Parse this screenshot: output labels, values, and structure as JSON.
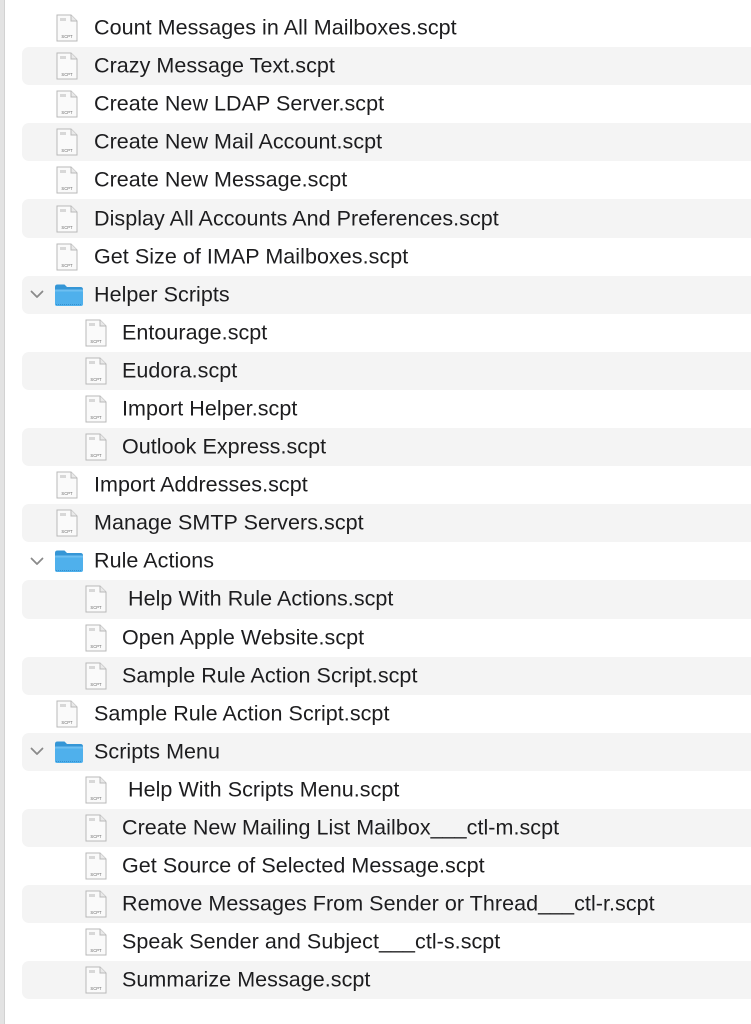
{
  "tree": {
    "items": [
      {
        "label": "Count Messages in All Mailboxes.scpt",
        "kind": "file",
        "level": 0,
        "icon": "scpt-file-icon",
        "icon_tag": "SCPT"
      },
      {
        "label": "Crazy Message Text.scpt",
        "kind": "file",
        "level": 0,
        "icon": "scpt-file-icon",
        "icon_tag": "SCPT"
      },
      {
        "label": "Create New LDAP Server.scpt",
        "kind": "file",
        "level": 0,
        "icon": "scpt-file-icon",
        "icon_tag": "SCPT"
      },
      {
        "label": "Create New Mail Account.scpt",
        "kind": "file",
        "level": 0,
        "icon": "scpt-file-icon",
        "icon_tag": "SCPT"
      },
      {
        "label": "Create New Message.scpt",
        "kind": "file",
        "level": 0,
        "icon": "scpt-file-icon",
        "icon_tag": "SCPT"
      },
      {
        "label": "Display All Accounts And Preferences.scpt",
        "kind": "file",
        "level": 0,
        "icon": "scpt-file-icon",
        "icon_tag": "SCPT"
      },
      {
        "label": "Get Size of IMAP Mailboxes.scpt",
        "kind": "file",
        "level": 0,
        "icon": "scpt-file-icon",
        "icon_tag": "SCPT"
      },
      {
        "label": "Helper Scripts",
        "kind": "folder",
        "level": 0,
        "expanded": true,
        "icon": "folder-icon"
      },
      {
        "label": "Entourage.scpt",
        "kind": "file",
        "level": 1,
        "icon": "scpt-file-icon",
        "icon_tag": "SCPT"
      },
      {
        "label": "Eudora.scpt",
        "kind": "file",
        "level": 1,
        "icon": "scpt-file-icon",
        "icon_tag": "SCPT"
      },
      {
        "label": "Import Helper.scpt",
        "kind": "file",
        "level": 1,
        "icon": "scpt-file-icon",
        "icon_tag": "SCPT"
      },
      {
        "label": "Outlook Express.scpt",
        "kind": "file",
        "level": 1,
        "icon": "scpt-file-icon",
        "icon_tag": "SCPT"
      },
      {
        "label": "Import Addresses.scpt",
        "kind": "file",
        "level": 0,
        "icon": "scpt-file-icon",
        "icon_tag": "SCPT"
      },
      {
        "label": "Manage SMTP Servers.scpt",
        "kind": "file",
        "level": 0,
        "icon": "scpt-file-icon",
        "icon_tag": "SCPT"
      },
      {
        "label": "Rule Actions",
        "kind": "folder",
        "level": 0,
        "expanded": true,
        "icon": "folder-icon"
      },
      {
        "label": " Help With Rule Actions.scpt",
        "kind": "file",
        "level": 1,
        "icon": "scpt-file-icon",
        "icon_tag": "SCPT"
      },
      {
        "label": "Open Apple Website.scpt",
        "kind": "file",
        "level": 1,
        "icon": "scpt-file-icon",
        "icon_tag": "SCPT"
      },
      {
        "label": "Sample Rule Action Script.scpt",
        "kind": "file",
        "level": 1,
        "icon": "scpt-file-icon",
        "icon_tag": "SCPT"
      },
      {
        "label": "Sample Rule Action Script.scpt",
        "kind": "file",
        "level": 0,
        "icon": "scpt-file-icon",
        "icon_tag": "SCPT"
      },
      {
        "label": "Scripts Menu",
        "kind": "folder",
        "level": 0,
        "expanded": true,
        "icon": "folder-icon"
      },
      {
        "label": " Help With Scripts Menu.scpt",
        "kind": "file",
        "level": 1,
        "icon": "scpt-file-icon",
        "icon_tag": "SCPT"
      },
      {
        "label": "Create New Mailing List Mailbox___ctl-m.scpt",
        "kind": "file",
        "level": 1,
        "icon": "scpt-file-icon",
        "icon_tag": "SCPT"
      },
      {
        "label": "Get Source of Selected Message.scpt",
        "kind": "file",
        "level": 1,
        "icon": "scpt-file-icon",
        "icon_tag": "SCPT"
      },
      {
        "label": "Remove Messages From Sender or Thread___ctl-r.scpt",
        "kind": "file",
        "level": 1,
        "icon": "scpt-file-icon",
        "icon_tag": "SCPT"
      },
      {
        "label": "Speak Sender and Subject___ctl-s.scpt",
        "kind": "file",
        "level": 1,
        "icon": "scpt-file-icon",
        "icon_tag": "SCPT"
      },
      {
        "label": "Summarize Message.scpt",
        "kind": "file",
        "level": 1,
        "icon": "scpt-file-icon",
        "icon_tag": "SCPT"
      }
    ]
  },
  "colors": {
    "alt_row": "#f4f4f4",
    "text": "#1d1d1f",
    "folder_body": "#4fb0ec",
    "folder_tab": "#3596d6",
    "chevron": "#8a8a8a"
  }
}
